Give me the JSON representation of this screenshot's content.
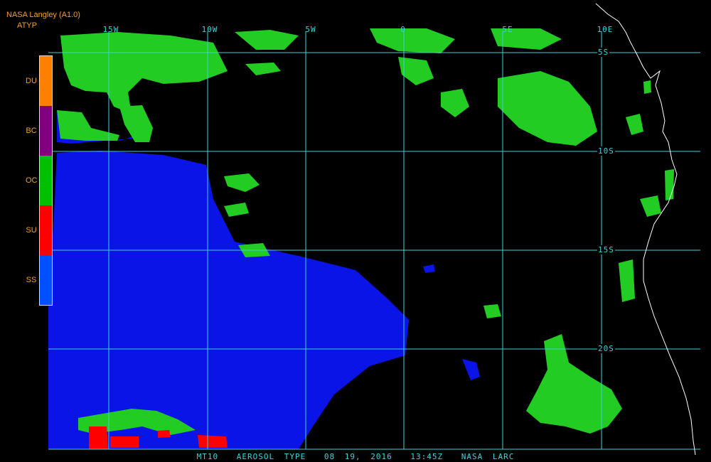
{
  "header": {
    "agency": "NASA Langley (A1.0)",
    "product": "ATYP"
  },
  "legend": [
    {
      "label": "DU",
      "color": "#ff8000"
    },
    {
      "label": "BC",
      "color": "#800080"
    },
    {
      "label": "OC",
      "color": "#00c000"
    },
    {
      "label": "SU",
      "color": "#ff0000"
    },
    {
      "label": "SS",
      "color": "#0050ff"
    }
  ],
  "longitude_labels": [
    "15W",
    "10W",
    "5W",
    "0",
    "5E",
    "10E"
  ],
  "latitude_labels": [
    "5S",
    "10S",
    "15S",
    "20S"
  ],
  "footer": {
    "satellite": "MT10",
    "product": "AEROSOL TYPE",
    "date": "08 19, 2016",
    "time": "13:45Z",
    "producer": "NASA LARC"
  },
  "colors": {
    "grid": "#40d0d8",
    "coast": "#ffffff",
    "oc": "#22cc22",
    "ss": "#0a14e6",
    "su": "#ff0000",
    "bc": "#800080",
    "du": "#ff8000"
  }
}
